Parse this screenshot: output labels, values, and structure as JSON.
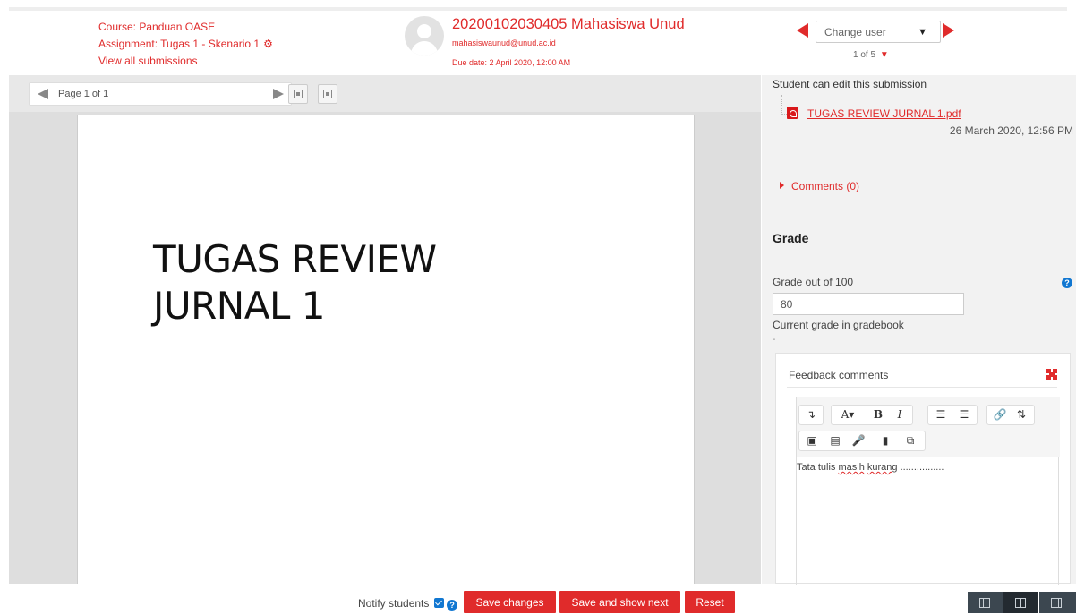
{
  "header": {
    "course": "Course: Panduan OASE",
    "assignment": "Assignment: Tugas 1 - Skenario 1",
    "view_all": "View all submissions",
    "user_name": "20200102030405 Mahasiswa Unud",
    "user_email": "mahasiswaunud@unud.ac.id",
    "due_date": "Due date: 2 April 2020, 12:00 AM",
    "change_user": "Change user",
    "counter": "1 of 5"
  },
  "viewer": {
    "page_label": "Page 1 of 1",
    "document_title_line1": "TUGAS REVIEW",
    "document_title_line2": "JURNAL 1"
  },
  "submission": {
    "status": "Student can edit this submission",
    "file_name": "TUGAS REVIEW JURNAL 1.pdf",
    "file_date": "26 March 2020, 12:56 PM",
    "comments": "Comments (0)"
  },
  "grade": {
    "heading": "Grade",
    "label": "Grade out of 100",
    "value": "80",
    "current_label": "Current grade in gradebook",
    "current_value": "-"
  },
  "feedback": {
    "title": "Feedback comments",
    "text_before": "Tata tulis ",
    "word1": "masih",
    "space": " ",
    "word2": "kurang",
    "text_after": " ................"
  },
  "footer": {
    "notify_label": "Notify students",
    "save_label": "Save changes",
    "save_next_label": "Save and show next",
    "reset_label": "Reset"
  },
  "colors": {
    "accent": "#e02b2b",
    "help": "#1177d1",
    "layout_bar": "#3c4750"
  }
}
